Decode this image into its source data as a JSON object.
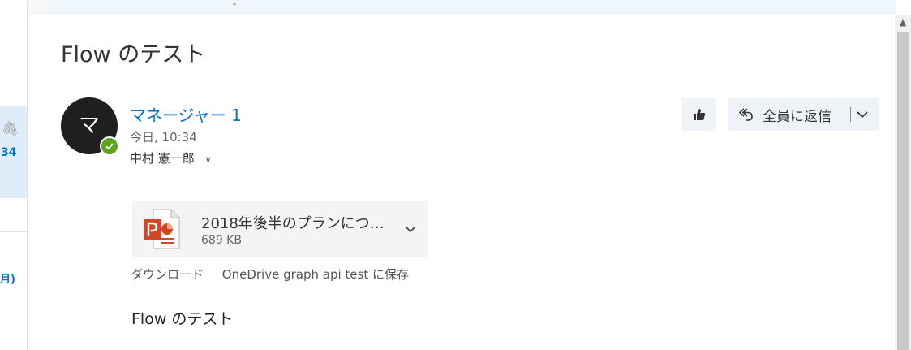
{
  "mail_list": {
    "time": "34",
    "month_fragment": "月)"
  },
  "message": {
    "subject": "Flow のテスト",
    "sender": {
      "initial": "マ",
      "name": "マネージャー 1",
      "presence": "online"
    },
    "datetime": "今日, 10:34",
    "recipient": "中村 憲一郎",
    "actions": {
      "reply_all_label": "全員に返信"
    },
    "attachment": {
      "name": "2018年後半のプランにつ…",
      "size": "689 KB",
      "download_label": "ダウンロード",
      "save_onedrive_label": "OneDrive graph api test に保存"
    },
    "body": "Flow のテスト"
  },
  "colors": {
    "accent": "#0072c6",
    "presence": "#5ca51b",
    "selected_item": "#deecf9",
    "powerpoint": "#d24726"
  }
}
